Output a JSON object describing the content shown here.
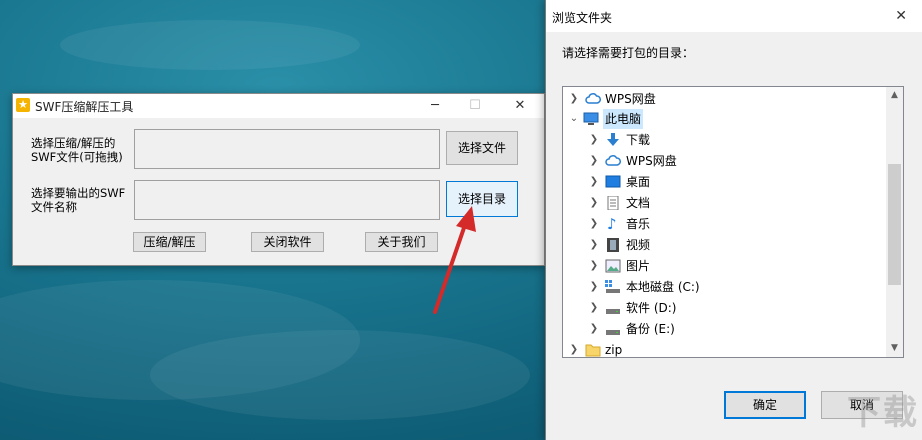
{
  "swf_window": {
    "title": "SWF压缩解压工具",
    "minimize": "─",
    "maximize": "☐",
    "close": "✕",
    "input_label": "选择压缩/解压的\nSWF文件(可拖拽)",
    "input_value": "",
    "select_file_button": "选择文件",
    "output_label": "选择要输出的SWF\n文件名称",
    "output_value": "",
    "select_dir_button": "选择目录",
    "compress_button": "压缩/解压",
    "close_software_button": "关闭软件",
    "about_button": "关于我们"
  },
  "browse_dialog": {
    "title": "浏览文件夹",
    "close": "✕",
    "prompt": "请选择需要打包的目录：",
    "tree": [
      {
        "label": "WPS网盘",
        "icon": "cloud-icon",
        "level": 0,
        "expanded": false
      },
      {
        "label": "此电脑",
        "icon": "computer-icon",
        "level": 0,
        "expanded": true,
        "selected": true
      },
      {
        "label": "下载",
        "icon": "download-icon",
        "level": 1,
        "expanded": false
      },
      {
        "label": "WPS网盘",
        "icon": "cloud-icon",
        "level": 1,
        "expanded": false
      },
      {
        "label": "桌面",
        "icon": "desktop-icon",
        "level": 1,
        "expanded": false
      },
      {
        "label": "文档",
        "icon": "document-icon",
        "level": 1,
        "expanded": false
      },
      {
        "label": "音乐",
        "icon": "music-icon",
        "level": 1,
        "expanded": false
      },
      {
        "label": "视频",
        "icon": "video-icon",
        "level": 1,
        "expanded": false
      },
      {
        "label": "图片",
        "icon": "picture-icon",
        "level": 1,
        "expanded": false
      },
      {
        "label": "本地磁盘 (C:)",
        "icon": "drive-icon",
        "level": 1,
        "expanded": false
      },
      {
        "label": "软件 (D:)",
        "icon": "drive-icon",
        "level": 1,
        "expanded": false
      },
      {
        "label": "备份 (E:)",
        "icon": "drive-icon",
        "level": 1,
        "expanded": false
      },
      {
        "label": "zip",
        "icon": "folder-icon",
        "level": 0,
        "expanded": false
      }
    ],
    "ok_button": "确定",
    "cancel_button": "取消",
    "watermark": "下载"
  },
  "colors": {
    "accent": "#0078d7",
    "selection": "#cce8ff",
    "arrow": "#d42a2a",
    "app_icon": "#f5b400"
  }
}
